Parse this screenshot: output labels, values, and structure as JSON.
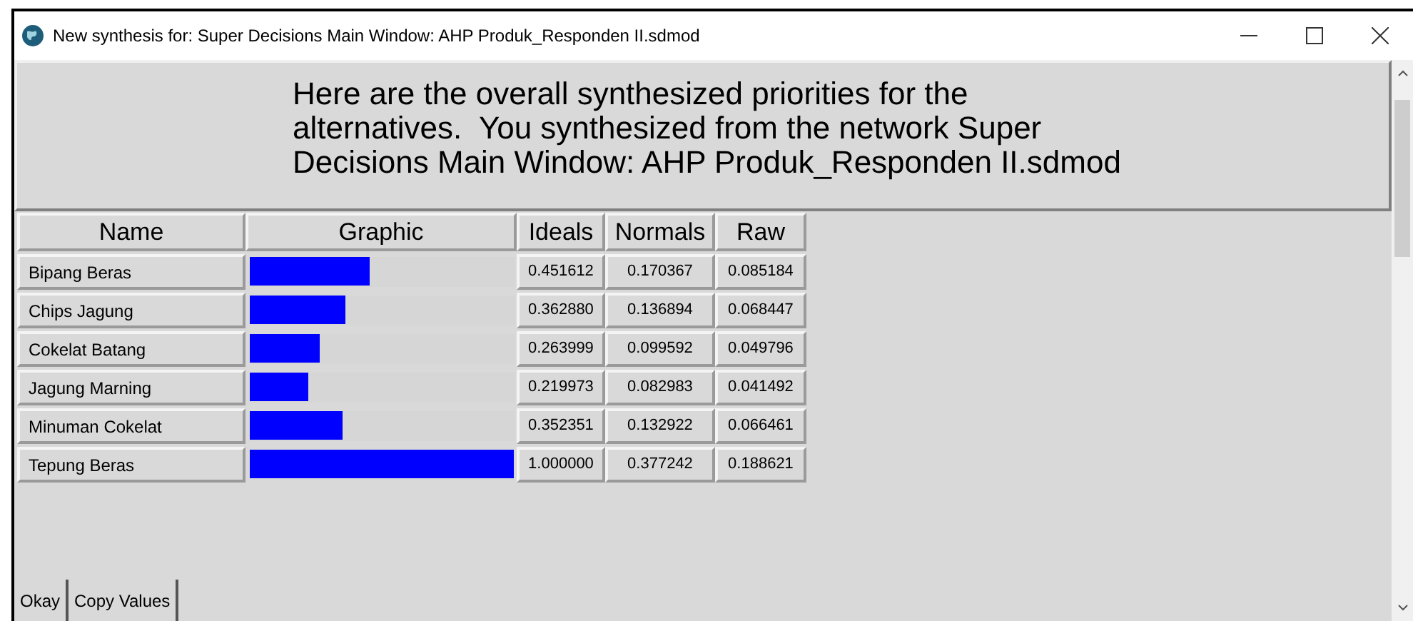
{
  "window": {
    "title": "New synthesis for: Super Decisions Main Window: AHP Produk_Responden II.sdmod"
  },
  "message": "Here are the overall synthesized priorities for the alternatives.  You synthesized from the network Super Decisions Main Window: AHP Produk_Responden II.sdmod",
  "table": {
    "columns": [
      "Name",
      "Graphic",
      "Ideals",
      "Normals",
      "Raw"
    ],
    "rows": [
      {
        "name": "Bipang Beras",
        "level": 0.451612,
        "ideals": "0.451612",
        "normals": "0.170367",
        "raw": "0.085184"
      },
      {
        "name": "Chips Jagung",
        "level": 0.36288,
        "ideals": "0.362880",
        "normals": "0.136894",
        "raw": "0.068447"
      },
      {
        "name": "Cokelat Batang",
        "level": 0.263999,
        "ideals": "0.263999",
        "normals": "0.099592",
        "raw": "0.049796"
      },
      {
        "name": "Jagung Marning",
        "level": 0.219973,
        "ideals": "0.219973",
        "normals": "0.082983",
        "raw": "0.041492"
      },
      {
        "name": "Minuman Cokelat",
        "level": 0.352351,
        "ideals": "0.352351",
        "normals": "0.132922",
        "raw": "0.066461"
      },
      {
        "name": "Tepung Beras",
        "level": 1.0,
        "ideals": "1.000000",
        "normals": "0.377242",
        "raw": "0.188621"
      }
    ]
  },
  "buttons": [
    "Okay",
    "Copy Values"
  ]
}
